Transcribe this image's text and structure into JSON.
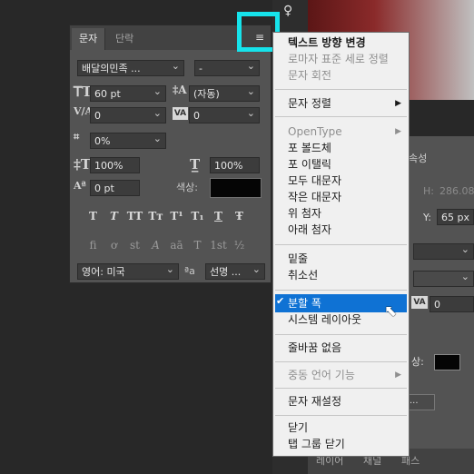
{
  "character_panel": {
    "tabs": [
      "문자",
      "단락"
    ],
    "collapse_glyph": "»",
    "menu_glyph": "≡",
    "font_family": "배달의민족 ...",
    "font_style": "-",
    "font_size": "60 pt",
    "leading": "(자동)",
    "kerning": "0",
    "tracking": "0",
    "tsume": "0%",
    "vertical_scale": "100%",
    "horizontal_scale": "100%",
    "baseline_shift": "0 pt",
    "color_label": "색상:",
    "language": "영어: 미국",
    "aa_label": "ªa",
    "antialias": "선명 ...",
    "style_buttons": [
      "T",
      "T",
      "TT",
      "Tт",
      "T¹",
      "T₁",
      "T",
      "Ŧ"
    ],
    "opentype_buttons": [
      "fi",
      "ơ",
      "st",
      "A",
      "aā",
      "T",
      "1st",
      "½"
    ]
  },
  "flyout_menu": {
    "groups": [
      [
        {
          "label": "텍스트 방향 변경",
          "enabled": true,
          "bold": true
        },
        {
          "label": "로마자 표준 세로 정렬",
          "enabled": false
        },
        {
          "label": "문자 회전",
          "enabled": false
        }
      ],
      [
        {
          "label": "문자 정렬",
          "enabled": true,
          "submenu": true
        }
      ],
      [
        {
          "label": "OpenType",
          "enabled": false,
          "submenu": true
        },
        {
          "label": "포 볼드체",
          "enabled": true
        },
        {
          "label": "포 이탤릭",
          "enabled": true
        },
        {
          "label": "모두 대문자",
          "enabled": true
        },
        {
          "label": "작은 대문자",
          "enabled": true
        },
        {
          "label": "위 첨자",
          "enabled": true
        },
        {
          "label": "아래 첨자",
          "enabled": true
        }
      ],
      [
        {
          "label": "밑줄",
          "enabled": true
        },
        {
          "label": "취소선",
          "enabled": true
        }
      ],
      [
        {
          "label": "분할 폭",
          "enabled": true,
          "checked": true,
          "highlighted": true
        },
        {
          "label": "시스템 레이아웃",
          "enabled": true
        }
      ],
      [
        {
          "label": "줄바꿈 없음",
          "enabled": true
        }
      ],
      [
        {
          "label": "중동 언어 기능",
          "enabled": false,
          "submenu": true
        }
      ],
      [
        {
          "label": "문자 재설정",
          "enabled": true
        }
      ],
      [
        {
          "label": "닫기",
          "enabled": true
        },
        {
          "label": "탭 그룹 닫기",
          "enabled": true
        }
      ]
    ]
  },
  "properties_panel": {
    "title_fragment": "속성",
    "h_label": "H:",
    "h_value": "286.08",
    "y_label": "Y:",
    "y_value": "65 px",
    "field_value": "0",
    "color_label": "상:",
    "bottom_tabs": [
      "레이어",
      "채널",
      "패스"
    ]
  },
  "colors": {
    "accent_highlight": "#16e3eb",
    "menu_selection": "#0f72d4",
    "panel_bg": "#535353"
  }
}
